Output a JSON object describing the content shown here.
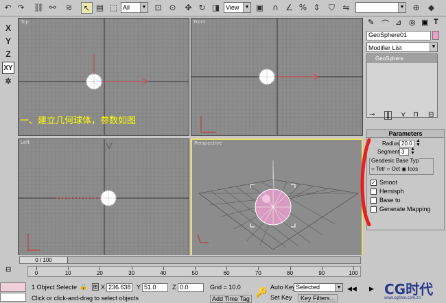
{
  "toolbar": {
    "selection_filter": "All",
    "ref_coord_system": "View",
    "named_selection": ""
  },
  "left_axes": [
    "X",
    "Y",
    "Z",
    "XY"
  ],
  "viewports": {
    "top_label": "Top",
    "front_label": "Front",
    "left_label": "Left",
    "persp_label": "Perspective",
    "annotation": "一、建立几何球体，参数如图"
  },
  "command_panel": {
    "object_name": "GeoSphere01",
    "object_color": "#e8a0c8",
    "modifier_list_label": "Modifier List",
    "stack_item": "GeoSphere",
    "rollout_title": "Parameters",
    "radius_label": "Radius:",
    "radius_value": "20.0",
    "segments_label": "Segments:",
    "segments_value": "3",
    "base_type_title": "Geodesic Base Typ",
    "base_tetra": "Tetr",
    "base_octa": "Oct",
    "base_icosa": "Icos",
    "smooth_label": "Smoot",
    "hemisphere_label": "Hemisph",
    "base_to_label": "Base to",
    "gen_mapping_label": "Generate Mapping"
  },
  "timeline": {
    "frame_counter": "0 / 100",
    "ticks": [
      "0",
      "10",
      "20",
      "30",
      "40",
      "50",
      "60",
      "70",
      "80",
      "90",
      "100"
    ]
  },
  "status": {
    "selection_count": "1 Object Selecte",
    "x_label": "X",
    "x_value": "236.638",
    "y_label": "Y",
    "y_value": "51.0",
    "z_label": "Z",
    "z_value": "0.0",
    "grid": "Grid = 10.0",
    "auto_key": "Auto Key",
    "set_key": "Set Key",
    "key_mode": "Selected",
    "key_filters": "Key Filters...",
    "prompt": "Click or click-and-drag to select objects",
    "add_time_tag": "Add Time Tag",
    "watermark": "CG时代",
    "watermark_url": "www.cgtime.com.cn"
  }
}
